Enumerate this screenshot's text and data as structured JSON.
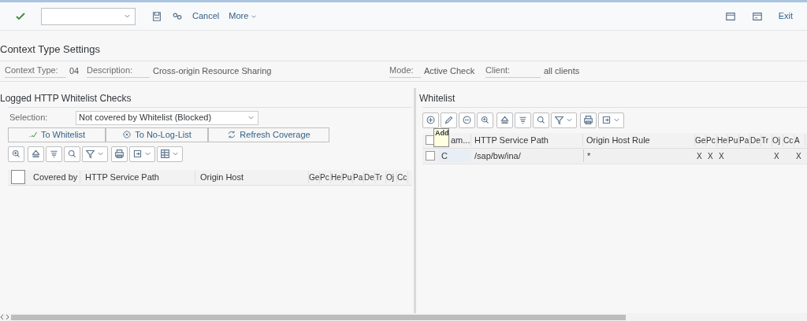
{
  "toolbar": {
    "buttons": [
      "Cancel",
      "More"
    ],
    "right_buttons": [
      "Exit"
    ]
  },
  "context": {
    "title": "Context Type Settings",
    "fields": [
      {
        "label": "Context Type:",
        "value": "04"
      },
      {
        "label": "Description:",
        "value": "Cross-origin Resource Sharing"
      },
      {
        "label": "Mode:",
        "value": "Active Check"
      },
      {
        "label": "Client:",
        "value": "all clients"
      }
    ]
  },
  "left_panel": {
    "title": "Logged HTTP Whitelist Checks",
    "selection": {
      "label": "Selection:",
      "value": "Not covered by Whitelist (Blocked)"
    },
    "actions": [
      "To Whitelist",
      "To No-Log-List",
      "Refresh Coverage"
    ],
    "table": {
      "select_all_checked": false,
      "columns": [
        "Covered by",
        "HTTP Service Path",
        "Origin Host",
        "Ge",
        "Pc",
        "He",
        "Pu",
        "Pa",
        "De",
        "Tr",
        "Oj",
        "Cc"
      ]
    }
  },
  "right_panel": {
    "title": "Whitelist",
    "tooltip": "Add",
    "table": {
      "select_all_checked": false,
      "columns": [
        "am...",
        "HTTP Service Path",
        "Origin Host Rule",
        "Ge",
        "Pc",
        "He",
        "Pu",
        "Pa",
        "De",
        "Tr",
        "Oj",
        "Cc",
        "A"
      ],
      "rows": [
        {
          "selected": false,
          "cells": [
            "C",
            "/sap/bw/ina/",
            "*",
            "X",
            "X",
            "X",
            "",
            "",
            "",
            "",
            "X",
            "",
            "X"
          ]
        }
      ]
    }
  }
}
